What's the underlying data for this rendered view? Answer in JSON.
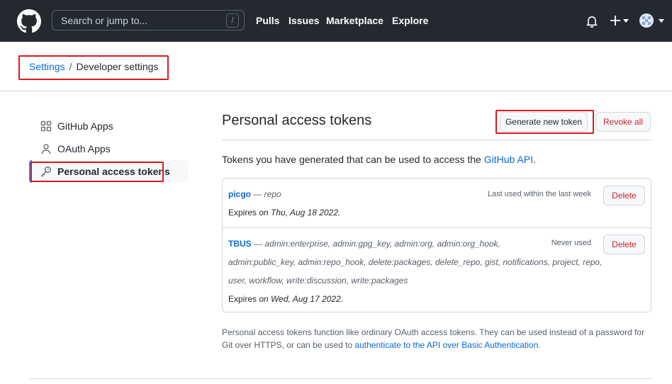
{
  "header": {
    "search_placeholder": "Search or jump to...",
    "search_shortcut": "/",
    "nav": [
      "Pulls",
      "Issues",
      "Marketplace",
      "Explore"
    ]
  },
  "breadcrumb": {
    "parent": "Settings",
    "separator": "/",
    "current": "Developer settings"
  },
  "sidebar": {
    "items": [
      {
        "label": "GitHub Apps",
        "icon": "apps-grid-icon",
        "active": false
      },
      {
        "label": "OAuth Apps",
        "icon": "person-icon",
        "active": false
      },
      {
        "label": "Personal access tokens",
        "icon": "key-icon",
        "active": true
      }
    ]
  },
  "main": {
    "title": "Personal access tokens",
    "generate_label": "Generate new token",
    "revoke_label": "Revoke all",
    "intro_prefix": "Tokens you have generated that can be used to access the ",
    "intro_link": "GitHub API",
    "intro_suffix": ".",
    "tokens": [
      {
        "name": "picgo",
        "dash": " — ",
        "scopes_lines": [
          "repo"
        ],
        "expires_label": "Expires",
        "expires_value": "on Thu, Aug 18 2022.",
        "last_used": "Last used within the last week",
        "delete_label": "Delete"
      },
      {
        "name": "TBUS",
        "dash": " — ",
        "scopes_lines": [
          "admin:enterprise, admin:gpg_key, admin:org, admin:org_hook,",
          "admin:public_key, admin:repo_hook, delete:packages, delete_repo, gist, notifications, project, repo,",
          "user, workflow, write:discussion, write:packages"
        ],
        "expires_label": "Expires",
        "expires_value": "on Wed, Aug 17 2022.",
        "last_used": "Never used",
        "delete_label": "Delete"
      }
    ],
    "footnote_text": "Personal access tokens function like ordinary OAuth access tokens. They can be used instead of a password for Git over HTTPS, or can be used to ",
    "footnote_link": "authenticate to the API over Basic Authentication",
    "footnote_end": "."
  },
  "colors": {
    "header_bg": "#24292f",
    "link": "#0969da",
    "danger": "#cf222e",
    "highlight_box": "#e0181b",
    "active_bar": "#2f81f7"
  }
}
